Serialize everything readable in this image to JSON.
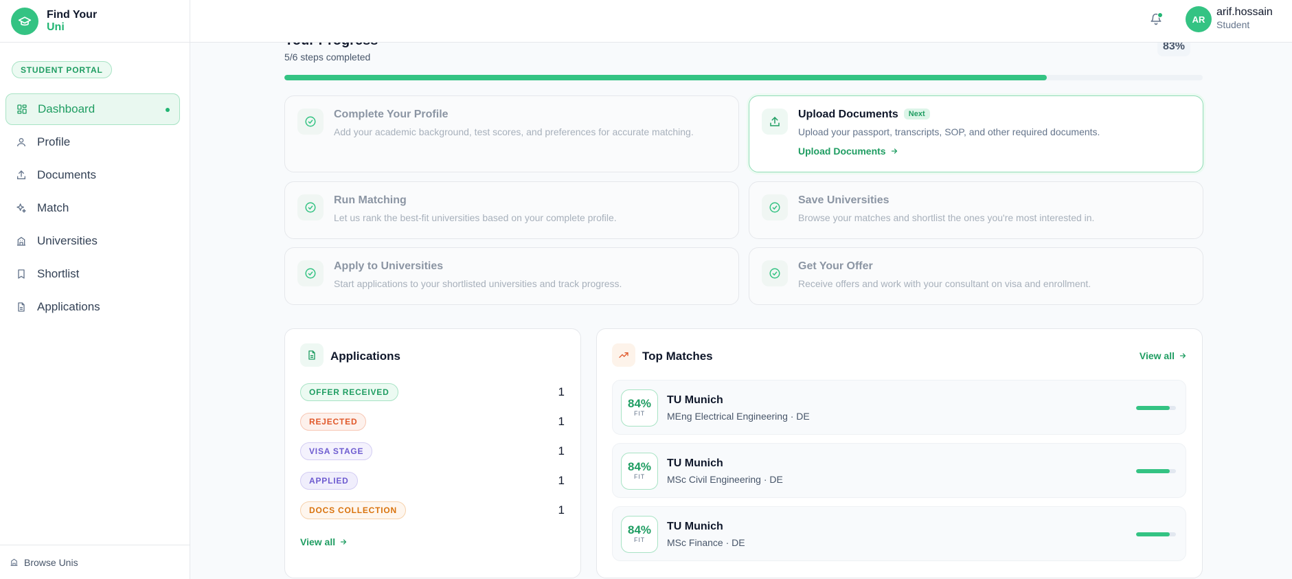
{
  "brand": {
    "line1": "Find Your",
    "line2": "Uni"
  },
  "sidebar": {
    "portal_badge": "STUDENT PORTAL",
    "items": [
      {
        "label": "Dashboard",
        "icon": "dashboard-icon",
        "active": true
      },
      {
        "label": "Profile",
        "icon": "user-icon"
      },
      {
        "label": "Documents",
        "icon": "upload-icon"
      },
      {
        "label": "Match",
        "icon": "sparkles-icon"
      },
      {
        "label": "Universities",
        "icon": "building-icon"
      },
      {
        "label": "Shortlist",
        "icon": "bookmark-icon"
      },
      {
        "label": "Applications",
        "icon": "file-text-icon"
      }
    ],
    "footer_link": "Browse Unis"
  },
  "topbar": {
    "avatar_initials": "AR",
    "user_name": "arif.hossain",
    "user_role": "Student"
  },
  "progress": {
    "title": "Your Progress",
    "subtitle": "5/6 steps completed",
    "percent_label": "83%",
    "percent": 83
  },
  "steps": [
    {
      "title": "Complete Your Profile",
      "desc": "Add your academic background, test scores, and preferences for accurate matching."
    },
    {
      "title": "Upload Documents",
      "badge": "Next",
      "desc": "Upload your passport, transcripts, SOP, and other required documents.",
      "link": "Upload Documents"
    },
    {
      "title": "Run Matching",
      "desc": "Let us rank the best-fit universities based on your complete profile."
    },
    {
      "title": "Save Universities",
      "desc": "Browse your matches and shortlist the ones you're most interested in."
    },
    {
      "title": "Apply to Universities",
      "desc": "Start applications to your shortlisted universities and track progress."
    },
    {
      "title": "Get Your Offer",
      "desc": "Receive offers and work with your consultant on visa and enrollment."
    }
  ],
  "applications": {
    "title": "Applications",
    "rows": [
      {
        "status": "OFFER RECEIVED",
        "count": "1",
        "color": "#1f9d62"
      },
      {
        "status": "REJECTED",
        "count": "1",
        "color": "#e0582a"
      },
      {
        "status": "VISA STAGE",
        "count": "1",
        "color": "#6d5bd0"
      },
      {
        "status": "APPLIED",
        "count": "1",
        "color": "#6d5bd0"
      },
      {
        "status": "DOCS COLLECTION",
        "count": "1",
        "color": "#d9730d"
      }
    ],
    "view_all": "View all"
  },
  "top_matches": {
    "title": "Top Matches",
    "view_all": "View all",
    "fit_label": "FIT",
    "items": [
      {
        "fit": "84%",
        "score": 84,
        "name": "TU Munich",
        "sub": "MEng Electrical Engineering · DE"
      },
      {
        "fit": "84%",
        "score": 84,
        "name": "TU Munich",
        "sub": "MSc Civil Engineering · DE"
      },
      {
        "fit": "84%",
        "score": 84,
        "name": "TU Munich",
        "sub": "MSc Finance · DE"
      }
    ]
  },
  "colors": {
    "accent": "#22b573",
    "accent_soft": "#ecfaf2"
  }
}
